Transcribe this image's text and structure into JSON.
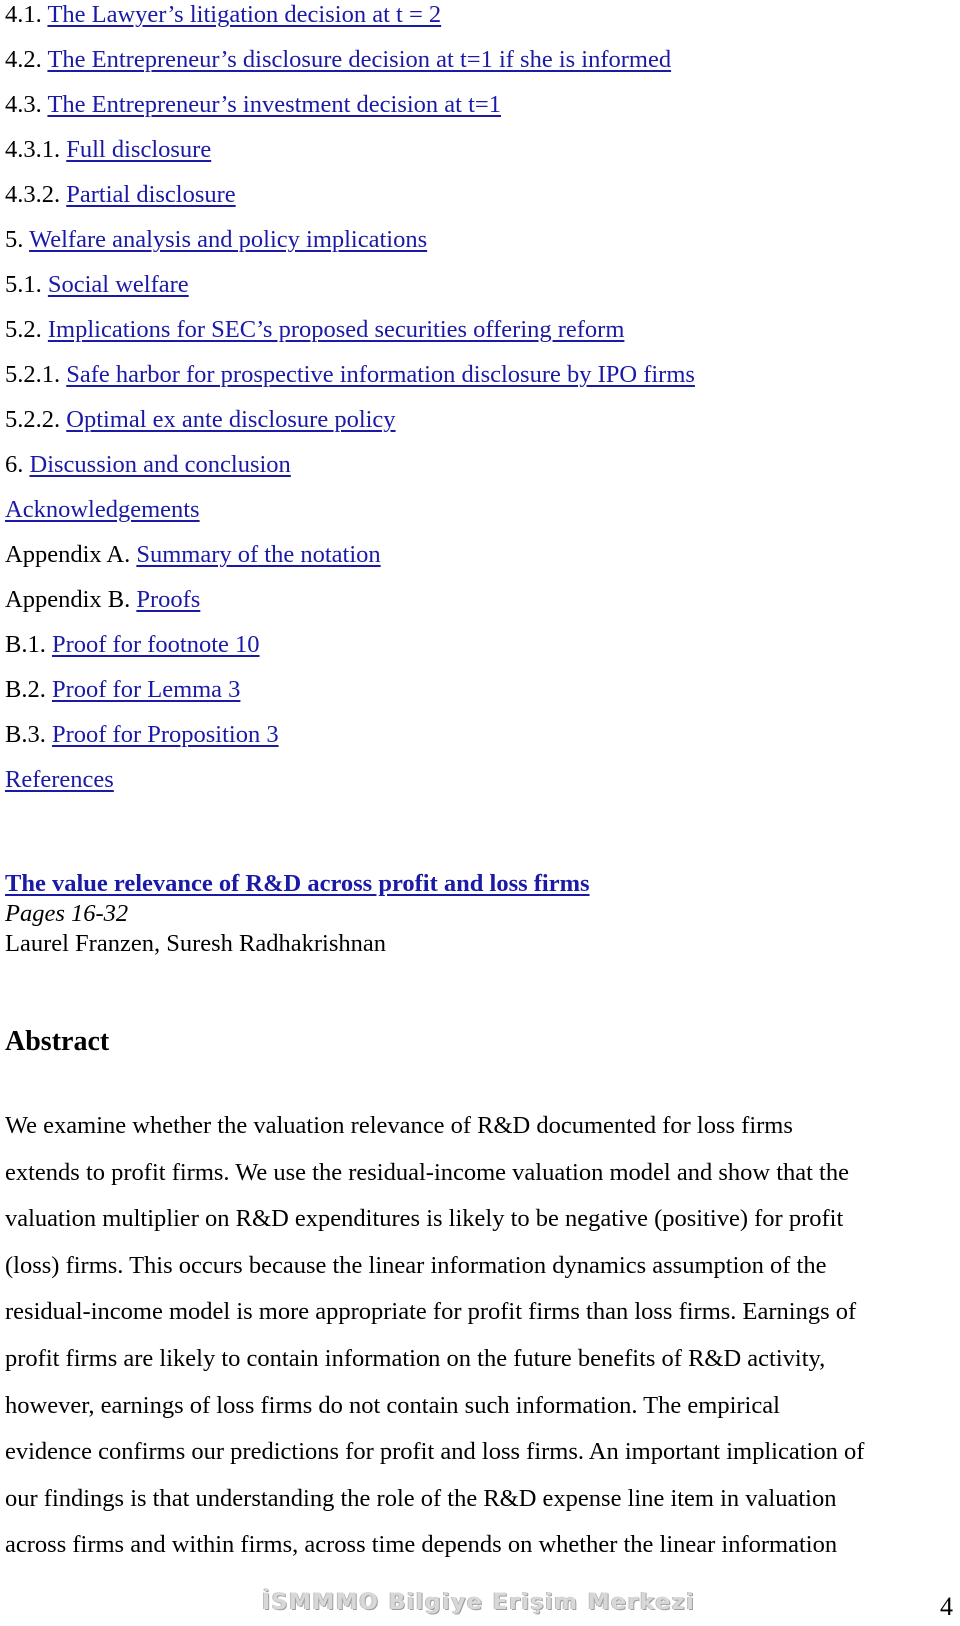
{
  "toc": {
    "items": [
      {
        "number": "4.1.",
        "label": "The Lawyer’s litigation decision at t = 2"
      },
      {
        "number": "4.2.",
        "label": "The Entrepreneur’s disclosure decision at t=1 if she is informed"
      },
      {
        "number": "4.3.",
        "label": "The Entrepreneur’s investment decision at t=1"
      },
      {
        "number": "4.3.1.",
        "label": "Full disclosure"
      },
      {
        "number": "4.3.2.",
        "label": "Partial disclosure"
      },
      {
        "number": "5.",
        "label": "Welfare analysis and policy implications"
      },
      {
        "number": "5.1.",
        "label": "Social welfare"
      },
      {
        "number": "5.2.",
        "label": "Implications for SEC’s proposed securities offering reform"
      },
      {
        "number": "5.2.1.",
        "label": "Safe harbor for prospective information disclosure by IPO firms"
      },
      {
        "number": "5.2.2.",
        "label": "Optimal ex ante disclosure policy"
      },
      {
        "number": "6.",
        "label": "Discussion and conclusion"
      },
      {
        "number": "",
        "label": "Acknowledgements"
      },
      {
        "number": "Appendix A.",
        "label": "Summary of the notation"
      },
      {
        "number": "Appendix B.",
        "label": "Proofs"
      },
      {
        "number": "B.1.",
        "label": "Proof for footnote 10"
      },
      {
        "number": "B.2.",
        "label": "Proof for Lemma 3"
      },
      {
        "number": "B.3.",
        "label": "Proof for Proposition 3"
      },
      {
        "number": "",
        "label": "References"
      }
    ]
  },
  "article": {
    "title": "The value relevance of R&D across profit and loss firms",
    "pages": "Pages 16-32",
    "authors": "Laurel Franzen, Suresh Radhakrishnan"
  },
  "abstract": {
    "heading": "Abstract",
    "lines": [
      "We examine whether the valuation relevance of R&D documented for loss firms",
      "extends to profit firms. We use the residual-income valuation model and show that the",
      "valuation multiplier on R&D expenditures is likely to be negative (positive) for profit",
      "(loss) firms. This occurs because the linear information dynamics assumption of the",
      "residual-income model is more appropriate for profit firms than loss firms. Earnings of",
      "profit firms are likely to contain information on the future benefits of R&D activity,",
      "however, earnings of loss firms do not contain such information. The empirical",
      "evidence confirms our predictions for profit and loss firms. An important implication of",
      "our findings is that understanding the role of the R&D expense line item in valuation",
      "across firms and within firms, across time depends on whether the linear information"
    ]
  },
  "footer": {
    "watermark": "İSMMMO Bilgiye Erişim Merkezi",
    "page_number": "4"
  }
}
